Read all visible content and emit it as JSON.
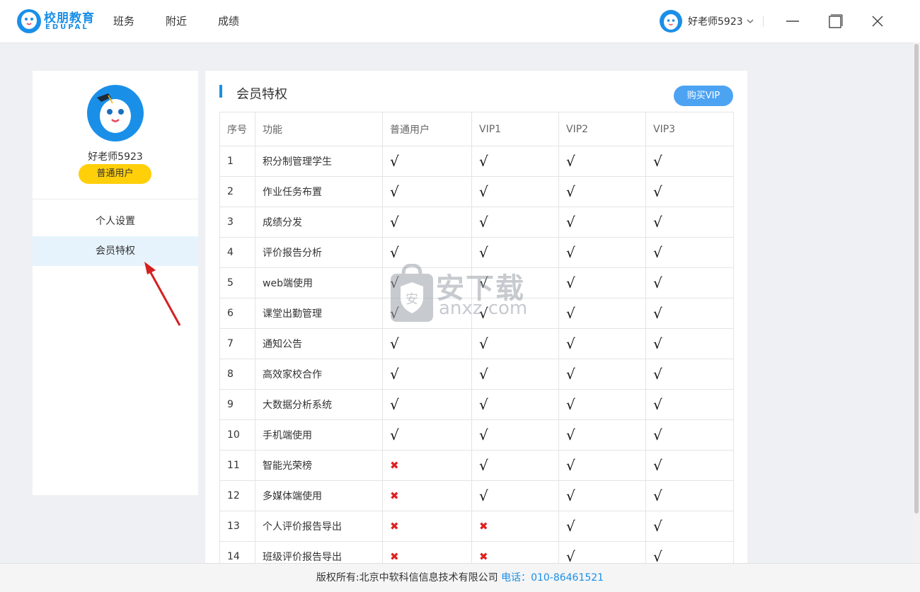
{
  "app": {
    "logo_cn": "校朋教育",
    "logo_en": "EDUPAL"
  },
  "nav": {
    "items": [
      {
        "label": "班务"
      },
      {
        "label": "附近"
      },
      {
        "label": "成绩"
      }
    ]
  },
  "user": {
    "name": "好老师5923",
    "badge": "普通用户"
  },
  "sidebar": {
    "menu": [
      {
        "label": "个人设置",
        "active": false
      },
      {
        "label": "会员特权",
        "active": true
      }
    ]
  },
  "main": {
    "title": "会员特权",
    "buy_button": "购买VIP",
    "columns": [
      "序号",
      "功能",
      "普通用户",
      "VIP1",
      "VIP2",
      "VIP3"
    ],
    "rows": [
      {
        "no": "1",
        "feature": "积分制管理学生",
        "perms": [
          true,
          true,
          true,
          true
        ]
      },
      {
        "no": "2",
        "feature": "作业任务布置",
        "perms": [
          true,
          true,
          true,
          true
        ]
      },
      {
        "no": "3",
        "feature": "成绩分发",
        "perms": [
          true,
          true,
          true,
          true
        ]
      },
      {
        "no": "4",
        "feature": "评价报告分析",
        "perms": [
          true,
          true,
          true,
          true
        ]
      },
      {
        "no": "5",
        "feature": "web端使用",
        "perms": [
          true,
          true,
          true,
          true
        ]
      },
      {
        "no": "6",
        "feature": "课堂出勤管理",
        "perms": [
          true,
          true,
          true,
          true
        ]
      },
      {
        "no": "7",
        "feature": "通知公告",
        "perms": [
          true,
          true,
          true,
          true
        ]
      },
      {
        "no": "8",
        "feature": "高效家校合作",
        "perms": [
          true,
          true,
          true,
          true
        ]
      },
      {
        "no": "9",
        "feature": "大数据分析系统",
        "perms": [
          true,
          true,
          true,
          true
        ]
      },
      {
        "no": "10",
        "feature": "手机端使用",
        "perms": [
          true,
          true,
          true,
          true
        ]
      },
      {
        "no": "11",
        "feature": "智能光荣榜",
        "perms": [
          false,
          true,
          true,
          true
        ]
      },
      {
        "no": "12",
        "feature": "多媒体端使用",
        "perms": [
          false,
          true,
          true,
          true
        ]
      },
      {
        "no": "13",
        "feature": "个人评价报告导出",
        "perms": [
          false,
          false,
          true,
          true
        ]
      },
      {
        "no": "14",
        "feature": "班级评价报告导出",
        "perms": [
          false,
          false,
          true,
          true
        ]
      }
    ],
    "yes_symbol": "√",
    "no_symbol": "✖"
  },
  "watermark": {
    "cn": "安下载",
    "en": "anxz.com",
    "shield": "安"
  },
  "footer": {
    "copyright": "版权所有:北京中软科信信息技术有限公司",
    "phone_label": "电话：",
    "phone": "010-86461521"
  },
  "icons": {
    "logo": "mascot-logo-icon",
    "avatar": "mascot-avatar-icon",
    "user_avatar": "mascot-small-avatar-icon",
    "dropdown": "chevron-down-icon",
    "minimize": "minimize-icon",
    "maximize": "maximize-icon",
    "close": "close-icon",
    "pointer": "red-arrow-icon"
  },
  "colors": {
    "accent": "#1a8fe8",
    "badge": "#ffcf0a",
    "active_menu": "#e6f3fd",
    "no_mark": "#e02020",
    "buy_button": "#4ca3f2"
  }
}
